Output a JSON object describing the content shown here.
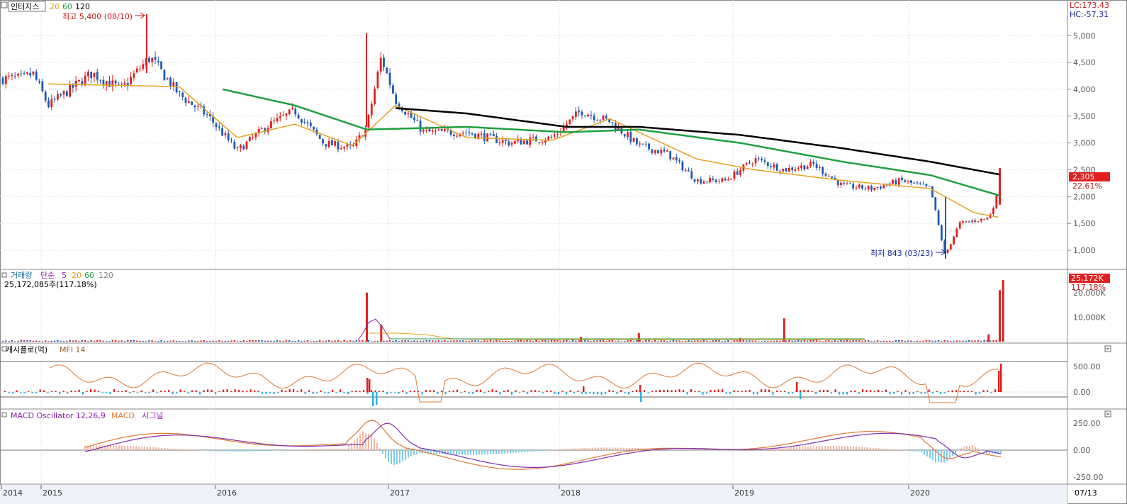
{
  "price_pane": {
    "legend": {
      "name": "인터지스",
      "ma20": "20",
      "ma60": "60",
      "ma120": "120"
    },
    "high_annotation": "최고 5,400 (08/10)",
    "low_annotation": "최저 843 (03/23)",
    "lc_label": "LC:173.43",
    "hc_label": "HC:-57.31",
    "current_price": "2,305",
    "current_change": "22.61%"
  },
  "volume_pane": {
    "legend": {
      "name": "거래량",
      "ma_label": "단순",
      "ma5": "5",
      "ma20": "20",
      "ma60": "60",
      "ma120": "120"
    },
    "info": "25,172,085주(117.18%)",
    "current_value": "25,172K",
    "current_change": "117.18%"
  },
  "mfi_pane": {
    "legend": {
      "name": "캐시플로(억)",
      "mfi": "MFI 14"
    }
  },
  "macd_pane": {
    "legend": {
      "osc": "MACD Oscillator 12,26,9",
      "macd": "MACD",
      "signal": "시그널"
    }
  },
  "x_axis_end": "07/13",
  "colors": {
    "up": "#e02020",
    "down": "#1e5ab4",
    "ma20": "#e8a020",
    "ma60": "#20a040",
    "ma120": "#000000",
    "mfi_line": "#e07830",
    "macd_line": "#e07830",
    "signal_line": "#8030b0",
    "osc_pos": "#f4b8a0",
    "osc_neg": "#80cce8",
    "cf_pos": "#e02020",
    "cf_neg": "#30b0e0"
  },
  "chart_data": [
    {
      "type": "candlestick",
      "title": "인터지스",
      "x_ticks": [
        "2014",
        "2015",
        "2016",
        "2017",
        "2018",
        "2019",
        "2020"
      ],
      "ylim": [
        750,
        5400
      ],
      "y_ticks": [
        1000,
        1500,
        2000,
        2500,
        3000,
        3500,
        4000,
        4500,
        5000
      ],
      "y_tick_labels": [
        "1,000",
        "1,500",
        "2,000",
        "2,500",
        "3,000",
        "3,500",
        "4,000",
        "4,500",
        "5,000"
      ],
      "approx_close_path": [
        {
          "date": "2014-07",
          "close": 4200
        },
        {
          "date": "2014-10",
          "close": 4300
        },
        {
          "date": "2015-01",
          "close": 3700
        },
        {
          "date": "2015-04",
          "close": 4300
        },
        {
          "date": "2015-06",
          "close": 4000
        },
        {
          "date": "2015-08",
          "close": 4600
        },
        {
          "date": "2015-10",
          "close": 3900
        },
        {
          "date": "2015-12",
          "close": 3500
        },
        {
          "date": "2016-02",
          "close": 2850
        },
        {
          "date": "2016-04",
          "close": 3300
        },
        {
          "date": "2016-06",
          "close": 3600
        },
        {
          "date": "2016-08",
          "close": 3000
        },
        {
          "date": "2016-10",
          "close": 2900
        },
        {
          "date": "2016-11",
          "close": 3300
        },
        {
          "date": "2016-12",
          "close": 4600
        },
        {
          "date": "2017-01",
          "close": 3800
        },
        {
          "date": "2017-03",
          "close": 3200
        },
        {
          "date": "2017-06",
          "close": 3200
        },
        {
          "date": "2017-09",
          "close": 3000
        },
        {
          "date": "2017-12",
          "close": 3100
        },
        {
          "date": "2018-02",
          "close": 3600
        },
        {
          "date": "2018-04",
          "close": 3400
        },
        {
          "date": "2018-06",
          "close": 2950
        },
        {
          "date": "2018-08",
          "close": 2800
        },
        {
          "date": "2018-10",
          "close": 2300
        },
        {
          "date": "2018-12",
          "close": 2300
        },
        {
          "date": "2019-02",
          "close": 2700
        },
        {
          "date": "2019-04",
          "close": 2500
        },
        {
          "date": "2019-06",
          "close": 2600
        },
        {
          "date": "2019-08",
          "close": 2200
        },
        {
          "date": "2019-10",
          "close": 2150
        },
        {
          "date": "2019-12",
          "close": 2300
        },
        {
          "date": "2020-02",
          "close": 2150
        },
        {
          "date": "2020-03",
          "close": 900
        },
        {
          "date": "2020-04",
          "close": 1500
        },
        {
          "date": "2020-06",
          "close": 1600
        },
        {
          "date": "2020-07",
          "close": 2305
        }
      ],
      "ma20_approx": [
        {
          "date": "2015-01",
          "value": 4100
        },
        {
          "date": "2015-10",
          "value": 4050
        },
        {
          "date": "2016-02",
          "value": 3100
        },
        {
          "date": "2016-06",
          "value": 3350
        },
        {
          "date": "2016-10",
          "value": 2950
        },
        {
          "date": "2017-01",
          "value": 3700
        },
        {
          "date": "2017-06",
          "value": 3100
        },
        {
          "date": "2017-12",
          "value": 3050
        },
        {
          "date": "2018-04",
          "value": 3450
        },
        {
          "date": "2018-10",
          "value": 2700
        },
        {
          "date": "2019-02",
          "value": 2500
        },
        {
          "date": "2019-08",
          "value": 2300
        },
        {
          "date": "2020-02",
          "value": 2150
        },
        {
          "date": "2020-05",
          "value": 1700
        },
        {
          "date": "2020-07",
          "value": 1600
        }
      ],
      "ma60_approx": [
        {
          "date": "2016-01",
          "value": 4000
        },
        {
          "date": "2016-06",
          "value": 3700
        },
        {
          "date": "2016-11",
          "value": 3250
        },
        {
          "date": "2017-06",
          "value": 3300
        },
        {
          "date": "2018-01",
          "value": 3200
        },
        {
          "date": "2018-06",
          "value": 3250
        },
        {
          "date": "2019-01",
          "value": 3000
        },
        {
          "date": "2019-08",
          "value": 2650
        },
        {
          "date": "2020-02",
          "value": 2400
        },
        {
          "date": "2020-07",
          "value": 2000
        }
      ],
      "ma120_approx": [
        {
          "date": "2017-01",
          "value": 3650
        },
        {
          "date": "2017-06",
          "value": 3550
        },
        {
          "date": "2018-01",
          "value": 3300
        },
        {
          "date": "2018-06",
          "value": 3300
        },
        {
          "date": "2019-01",
          "value": 3150
        },
        {
          "date": "2019-08",
          "value": 2900
        },
        {
          "date": "2020-02",
          "value": 2650
        },
        {
          "date": "2020-07",
          "value": 2400
        }
      ]
    },
    {
      "type": "bar",
      "title": "거래량",
      "y_ticks": [
        10000,
        20000
      ],
      "y_tick_labels": [
        "10,000K",
        "20,000K"
      ],
      "spikes_approx": [
        {
          "date": "2016-11",
          "value": 20000
        },
        {
          "date": "2016-12",
          "value": 7000
        },
        {
          "date": "2018-02",
          "value": 2000
        },
        {
          "date": "2018-06",
          "value": 3500
        },
        {
          "date": "2019-01",
          "value": 1500
        },
        {
          "date": "2019-04",
          "value": 9500
        },
        {
          "date": "2020-06",
          "value": 3000
        },
        {
          "date": "2020-07",
          "value": 25172
        }
      ]
    },
    {
      "type": "line",
      "title": "MFI 14",
      "y_ticks": [
        0,
        500
      ],
      "y_tick_labels": [
        "0.00",
        "500.00"
      ]
    },
    {
      "type": "line",
      "title": "MACD Oscillator 12,26,9",
      "y_ticks": [
        -250,
        0,
        250
      ],
      "y_tick_labels": [
        "-250.00",
        "0.00",
        "250.00"
      ]
    }
  ]
}
